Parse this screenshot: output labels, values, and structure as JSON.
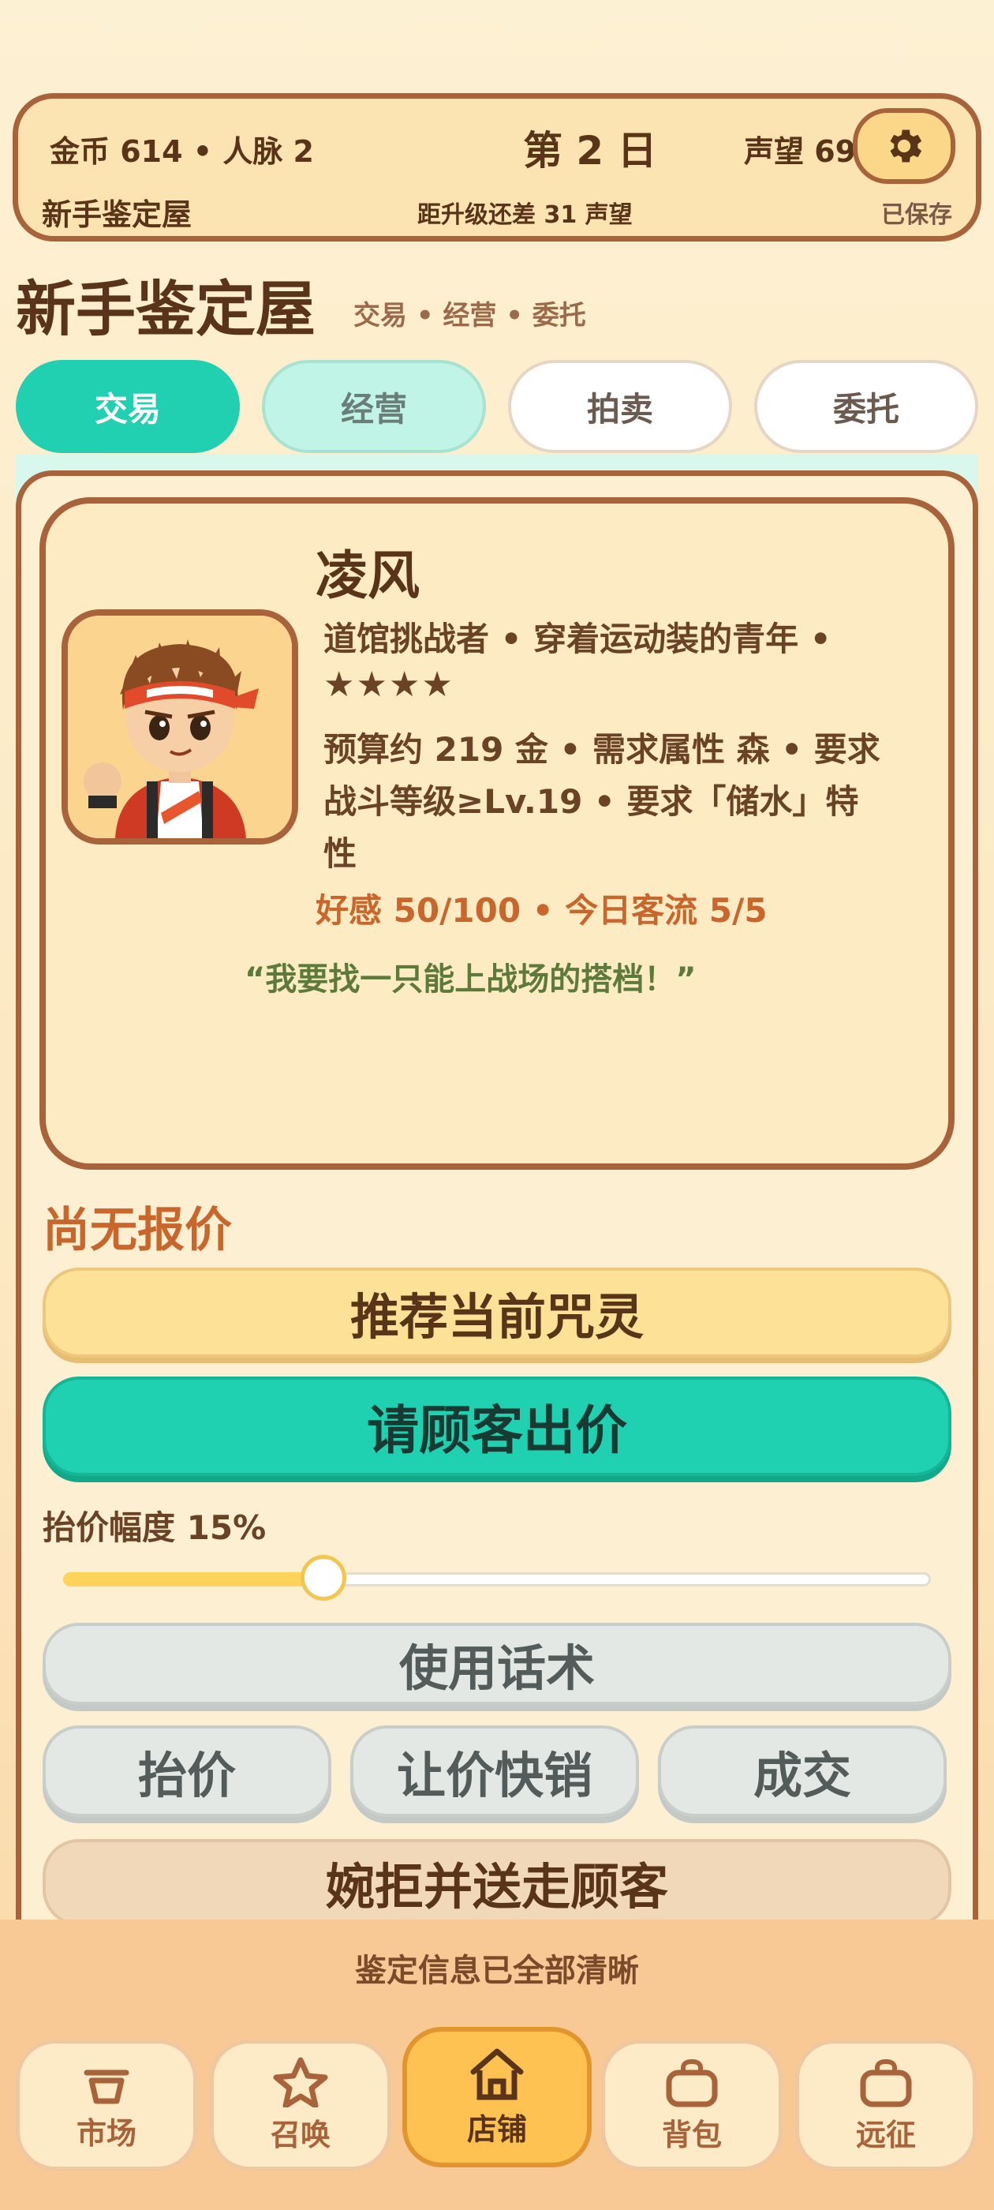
{
  "status": {
    "gold": "金币 614",
    "contacts": "人脉 2",
    "separator": "•",
    "day": "第 2 日",
    "reputation": "声望 69",
    "shop_rank": "新手鉴定屋",
    "upgrade_hint": "距升级还差 31 声望",
    "save_status": "已保存",
    "settings_icon": "gear-icon"
  },
  "header": {
    "title": "新手鉴定屋",
    "subtitle": "交易 • 经营 • 委托"
  },
  "tabs": [
    {
      "label": "交易",
      "active": true
    },
    {
      "label": "经营",
      "active": false
    },
    {
      "label": "拍卖",
      "active": false
    },
    {
      "label": "委托",
      "active": false
    }
  ],
  "customer": {
    "name": "凌风",
    "desc_line1": "道馆挑战者 • 穿着运动装的青年 •",
    "stars": "★★★★",
    "star_count": 4,
    "req_line1": "预算约 219 金 • 需求属性 森 • 要求",
    "req_line2": "战斗等级≥Lv.19 • 要求「储水」特",
    "req_line3": "性",
    "affinity": "好感 50/100 • 今日客流 5/5",
    "quote": "“我要找一只能上战场的搭档！”"
  },
  "offer": {
    "status": "尚无报价",
    "recommend_label": "推荐当前咒灵",
    "ask_price_label": "请顾客出价",
    "raise_range_label": "抬价幅度 15%",
    "raise_range_value": 0.15,
    "talk_label": "使用话术",
    "raise_label": "抬价",
    "discount_label": "让价快销",
    "deal_label": "成交",
    "decline_label": "婉拒并送走顾客"
  },
  "footer": {
    "info": "鉴定信息已全部清晰"
  },
  "nav": [
    {
      "label": "市场",
      "icon": "basket-icon",
      "active": false
    },
    {
      "label": "召唤",
      "icon": "star-icon",
      "active": false
    },
    {
      "label": "店铺",
      "icon": "house-icon",
      "active": true
    },
    {
      "label": "背包",
      "icon": "bag-icon",
      "active": false
    },
    {
      "label": "远征",
      "icon": "briefcase-icon",
      "active": false
    }
  ],
  "colors": {
    "brown": "#a8633a",
    "teal": "#1fd1b0",
    "orange_text": "#c8662c",
    "green_text": "#5d7a3a"
  }
}
